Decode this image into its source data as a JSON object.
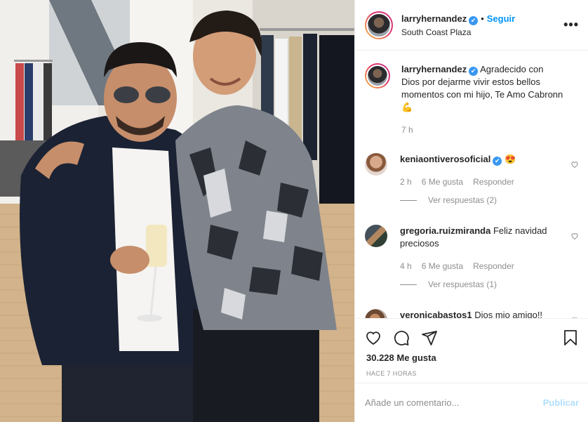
{
  "header": {
    "username": "larryhernandez",
    "verified_mark": "✔",
    "separator": "•",
    "follow_label": "Seguir",
    "location": "South Coast Plaza",
    "more_icon": "more-horizontal-icon"
  },
  "caption": {
    "username": "larryhernandez",
    "text": "Agradecido con Dios por dejarme vivir estos bellos momentos con mi hijo, Te Amo Cabronn",
    "emoji": "💪",
    "age": "7 h"
  },
  "comments": [
    {
      "username": "keniaontiverosoficial",
      "verified": true,
      "text": "😍",
      "age": "2 h",
      "likes": "6 Me gusta",
      "reply_label": "Responder",
      "view_replies": "Ver respuestas (2)"
    },
    {
      "username": "gregoria.ruizmiranda",
      "verified": false,
      "text": "Feliz navidad preciosos",
      "age": "4 h",
      "likes": "6 Me gusta",
      "reply_label": "Responder",
      "view_replies": "Ver respuestas (1)"
    },
    {
      "username": "veronicabastos1",
      "verified": false,
      "text": "Dios mio amigo!! Cuánto ha crecido!!!!! Que bello",
      "age": "",
      "likes": "",
      "reply_label": "",
      "view_replies": ""
    }
  ],
  "actions": {
    "like_icon": "heart-icon",
    "comment_icon": "comment-icon",
    "share_icon": "share-icon",
    "save_icon": "bookmark-icon",
    "likes_count": "30.228 Me gusta",
    "time_ago": "HACE 7 HORAS"
  },
  "add_comment": {
    "placeholder": "Añade un comentario...",
    "publish_label": "Publicar"
  },
  "colors": {
    "accent": "#0095f6",
    "publish_disabled": "#b2dffc",
    "verified": "#3897f0",
    "muted": "#8e8e8e"
  }
}
